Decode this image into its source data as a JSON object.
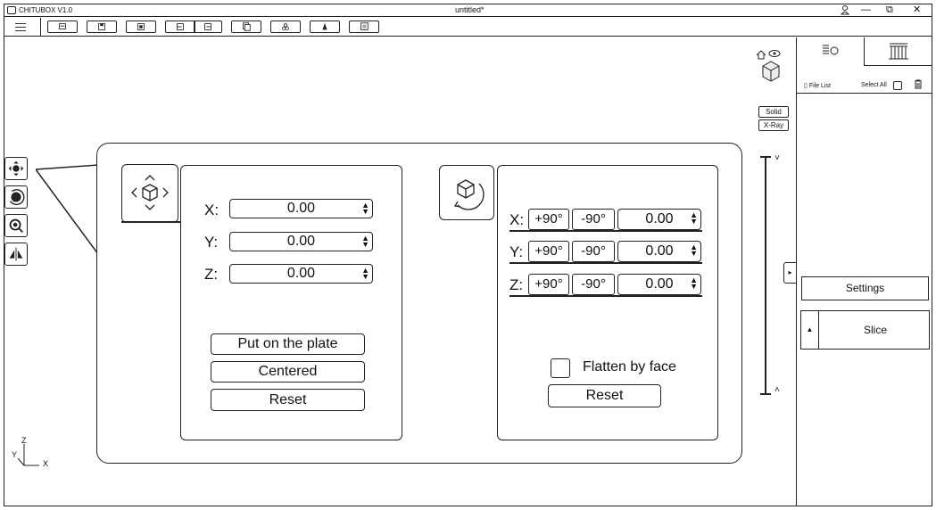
{
  "app": {
    "name": "CHITUBOX V1.0",
    "document_title": "untitled*"
  },
  "window": {
    "user_icon": "user-icon",
    "minimize": "—",
    "restore": "⧉",
    "close": "✕"
  },
  "toolbar": {
    "menu_icon": "hamburger-icon",
    "buttons": [
      "open-file-icon",
      "save-icon",
      "import-icon",
      "undo-icon",
      "redo-icon",
      "copy-icon",
      "support-icon",
      "fill-icon",
      "settings-panel-icon"
    ]
  },
  "view": {
    "solid": "Solid",
    "xray": "X-Ray"
  },
  "left_tools": [
    "move-icon",
    "rotate-icon",
    "scale-icon",
    "mirror-icon"
  ],
  "move_panel": {
    "x_label": "X:",
    "y_label": "Y:",
    "z_label": "Z:",
    "x_value": "0.00",
    "y_value": "0.00",
    "z_value": "0.00",
    "put_on_plate": "Put on the plate",
    "centered": "Centered",
    "reset": "Reset"
  },
  "rotate_panel": {
    "x_label": "X:",
    "y_label": "Y:",
    "z_label": "Z:",
    "plus90": "+90°",
    "minus90": "-90°",
    "x_value": "0.00",
    "y_value": "0.00",
    "z_value": "0.00",
    "flatten_by_face": "Flatten by face",
    "reset": "Reset"
  },
  "right_panel": {
    "file_list": "File List",
    "select_all": "Select All",
    "settings": "Settings",
    "slice": "Slice"
  },
  "axes": {
    "x": "X",
    "y": "Y",
    "z": "Z"
  }
}
